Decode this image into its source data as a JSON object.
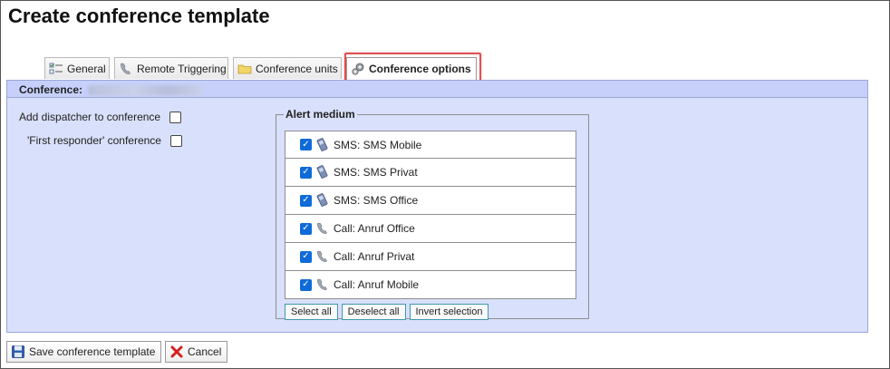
{
  "page": {
    "title": "Create conference template"
  },
  "tabs": [
    {
      "label": "General",
      "icon": "checklist-icon",
      "active": false
    },
    {
      "label": "Remote Triggering",
      "icon": "phone-icon",
      "active": false
    },
    {
      "label": "Conference units",
      "icon": "folder-icon",
      "active": false
    },
    {
      "label": "Conference options",
      "icon": "gears-icon",
      "active": true
    }
  ],
  "panel": {
    "header_label": "Conference:",
    "options": [
      {
        "label": "Add dispatcher to conference",
        "checked": false
      },
      {
        "label": "'First responder' conference",
        "checked": false
      }
    ],
    "alert_medium": {
      "legend": "Alert medium",
      "items": [
        {
          "label": "SMS: SMS Mobile",
          "icon": "mobile-phone-icon",
          "checked": true
        },
        {
          "label": "SMS: SMS Privat",
          "icon": "mobile-phone-icon",
          "checked": true
        },
        {
          "label": "SMS: SMS Office",
          "icon": "mobile-phone-icon",
          "checked": true
        },
        {
          "label": "Call: Anruf Office",
          "icon": "phone-handset-icon",
          "checked": true
        },
        {
          "label": "Call: Anruf Privat",
          "icon": "phone-handset-icon",
          "checked": true
        },
        {
          "label": "Call: Anruf Mobile",
          "icon": "phone-handset-icon",
          "checked": true
        }
      ],
      "buttons": {
        "select_all": "Select all",
        "deselect_all": "Deselect all",
        "invert_selection": "Invert selection"
      }
    }
  },
  "footer": {
    "save_label": "Save conference template",
    "cancel_label": "Cancel"
  },
  "colors": {
    "panel_bg": "#d9e0fb",
    "panel_header_bg": "#c6d0fa",
    "checkbox_blue": "#0f6bd7",
    "highlight_red": "#e05050"
  }
}
